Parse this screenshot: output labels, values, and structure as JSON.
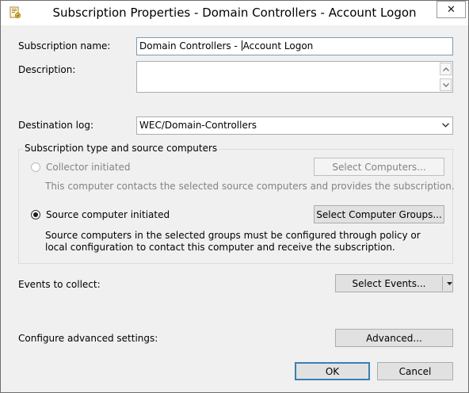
{
  "window": {
    "title": "Subscription Properties - Domain Controllers - Account Logon",
    "close_glyph": "✕"
  },
  "form": {
    "subscription_name_label": "Subscription name:",
    "subscription_name_value_before": "Domain Controllers - ",
    "subscription_name_value_after": "Account Logon",
    "description_label": "Description:",
    "description_value": "",
    "destination_log_label": "Destination log:",
    "destination_log_value": "WEC/Domain-Controllers"
  },
  "subscription_type": {
    "group_title": "Subscription type and source computers",
    "collector_initiated": {
      "label": "Collector initiated",
      "selected": false,
      "enabled": false,
      "button_label": "Select Computers...",
      "description": "This computer contacts the selected source computers and provides the subscription."
    },
    "source_initiated": {
      "label": "Source computer initiated",
      "selected": true,
      "enabled": true,
      "button_label": "Select Computer Groups...",
      "description_line1": "Source computers in the selected groups must be configured through policy or",
      "description_line2": "local configuration to contact this computer and receive the subscription."
    }
  },
  "events": {
    "label": "Events to collect:",
    "button_label": "Select Events..."
  },
  "advanced": {
    "label": "Configure advanced settings:",
    "button_label": "Advanced..."
  },
  "footer": {
    "ok_label": "OK",
    "cancel_label": "Cancel"
  },
  "colors": {
    "window_bg": "#f0f0f0",
    "button_bg": "#e1e1e1",
    "default_button_border": "#3c7fb1",
    "disabled_text": "#838383"
  },
  "icons": {
    "title": "subscription-properties-icon",
    "close": "close-icon",
    "dropdown": "chevron-down-icon",
    "scroll_up": "scroll-up-icon",
    "scroll_down": "scroll-down-icon"
  }
}
